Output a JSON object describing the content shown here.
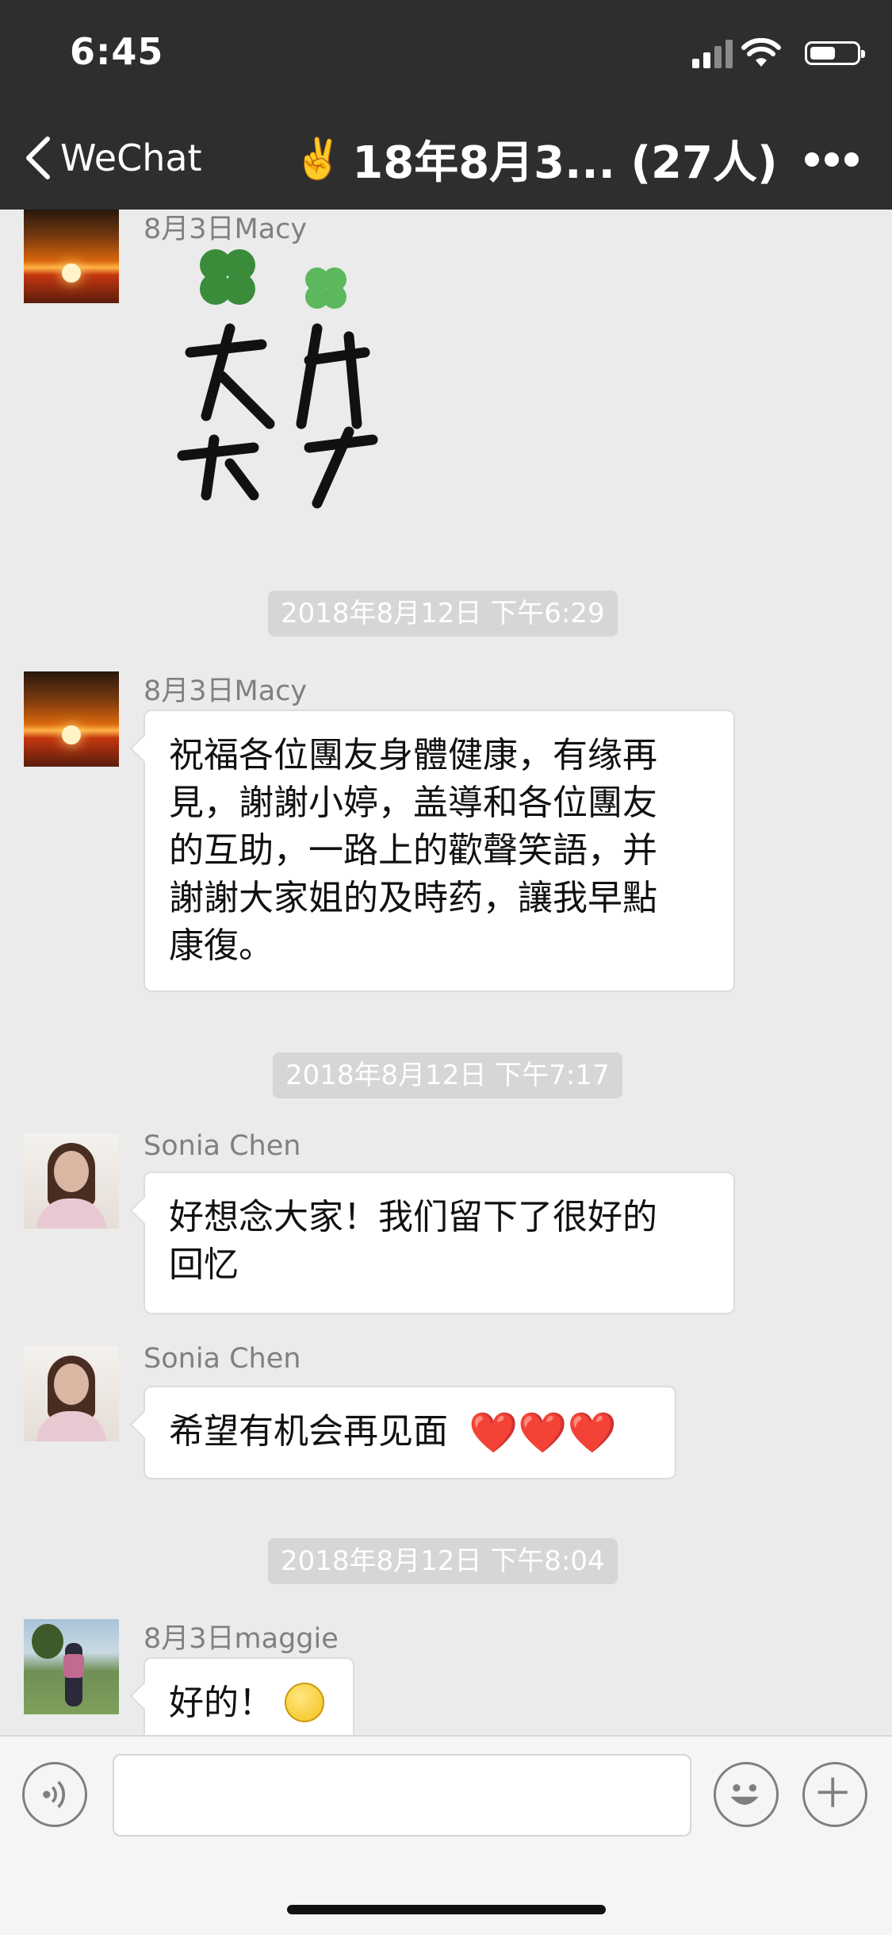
{
  "status_bar": {
    "time": "6:45",
    "battery_level": 0.55
  },
  "nav": {
    "back_label": "WeChat",
    "title_emoji": "✌️",
    "title": "18年8月3... (27人)"
  },
  "messages": [
    {
      "sender": "8月3日Macy",
      "type": "sticker",
      "sticker_text": "友谊万岁"
    },
    {
      "timestamp": "2018年8月12日 下午6:29"
    },
    {
      "sender": "8月3日Macy",
      "lines": [
        "祝福各位團友身體健康，有缘再",
        "見，謝謝小婷，盖導和各位團友",
        "的互助，一路上的歡聲笑語，并",
        "謝謝大家姐的及時药，讓我早點",
        "康復。"
      ]
    },
    {
      "timestamp": "2018年8月12日 下午7:17"
    },
    {
      "sender": "Sonia Chen",
      "lines": [
        "好想念大家！我们留下了很好的",
        "回忆"
      ]
    },
    {
      "sender": "Sonia Chen",
      "text": "希望有机会再见面",
      "emoji": "❤️❤️❤️"
    },
    {
      "timestamp": "2018年8月12日 下午8:04"
    },
    {
      "sender": "8月3日maggie",
      "text": "好的！"
    }
  ],
  "input": {
    "placeholder": ""
  },
  "icons": {
    "voice": "voice-icon",
    "emoji": "emoji-icon",
    "plus": "plus-icon"
  }
}
